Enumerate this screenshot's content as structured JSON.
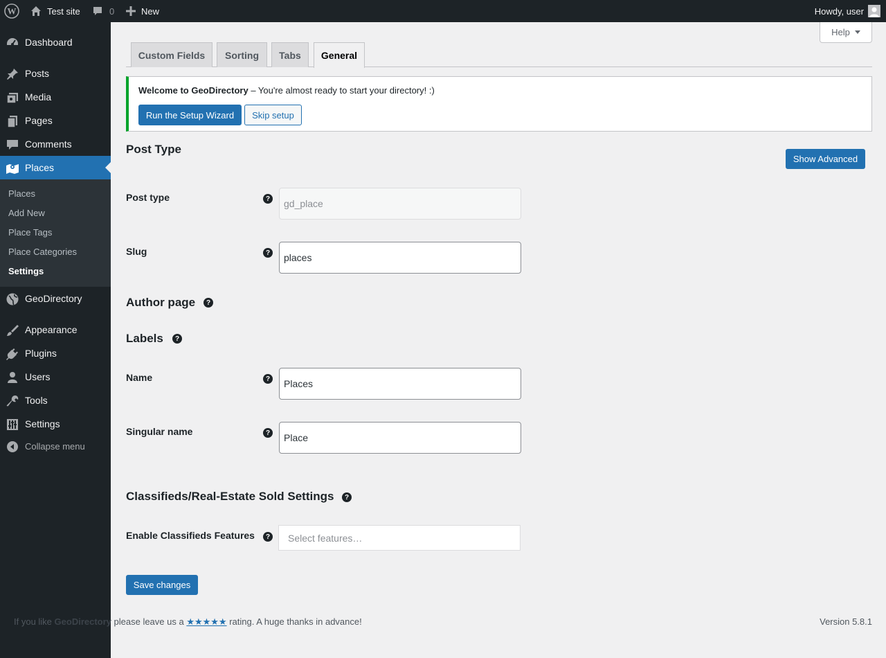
{
  "admin_bar": {
    "site_name": "Test site",
    "comments_count": "0",
    "new_label": "New",
    "howdy": "Howdy, user"
  },
  "sidebar": {
    "items": [
      {
        "label": "Dashboard",
        "icon": "dashboard-icon"
      },
      {
        "label": "Posts",
        "icon": "pin-icon"
      },
      {
        "label": "Media",
        "icon": "media-icon"
      },
      {
        "label": "Pages",
        "icon": "pages-icon"
      },
      {
        "label": "Comments",
        "icon": "comment-icon"
      },
      {
        "label": "Places",
        "icon": "map-icon"
      },
      {
        "label": "GeoDirectory",
        "icon": "globe-icon"
      },
      {
        "label": "Appearance",
        "icon": "brush-icon"
      },
      {
        "label": "Plugins",
        "icon": "plug-icon"
      },
      {
        "label": "Users",
        "icon": "user-icon"
      },
      {
        "label": "Tools",
        "icon": "wrench-icon"
      },
      {
        "label": "Settings",
        "icon": "settings-icon"
      }
    ],
    "submenu": [
      "Places",
      "Add New",
      "Place Tags",
      "Place Categories",
      "Settings"
    ],
    "collapse_label": "Collapse menu"
  },
  "help_label": "Help",
  "tabs": [
    "Custom Fields",
    "Sorting",
    "Tabs",
    "General"
  ],
  "notice": {
    "title": "Welcome to GeoDirectory",
    "text": " – You're almost ready to start your directory! :)",
    "primary_button": "Run the Setup Wizard",
    "secondary_button": "Skip setup"
  },
  "post_type_section": {
    "heading": "Post Type",
    "show_advanced": "Show Advanced",
    "post_type_label": "Post type",
    "post_type_value": "gd_place",
    "slug_label": "Slug",
    "slug_value": "places"
  },
  "author_page_heading": "Author page",
  "labels_section": {
    "heading": "Labels",
    "name_label": "Name",
    "name_value": "Places",
    "singular_label": "Singular name",
    "singular_value": "Place"
  },
  "classifieds_section": {
    "heading": "Classifieds/Real-Estate Sold Settings",
    "features_label": "Enable Classifieds Features",
    "features_placeholder": "Select features…"
  },
  "save_button": "Save changes",
  "footer": {
    "prefix": "If you like ",
    "brand": "GeoDirectory",
    "middle": " please leave us a ",
    "stars": "★★★★★",
    "suffix": " rating. A huge thanks in advance!",
    "version": "Version 5.8.1"
  },
  "colors": {
    "accent": "#2271b1",
    "notice_border": "#00a32a",
    "admin_bg": "#1d2327"
  }
}
